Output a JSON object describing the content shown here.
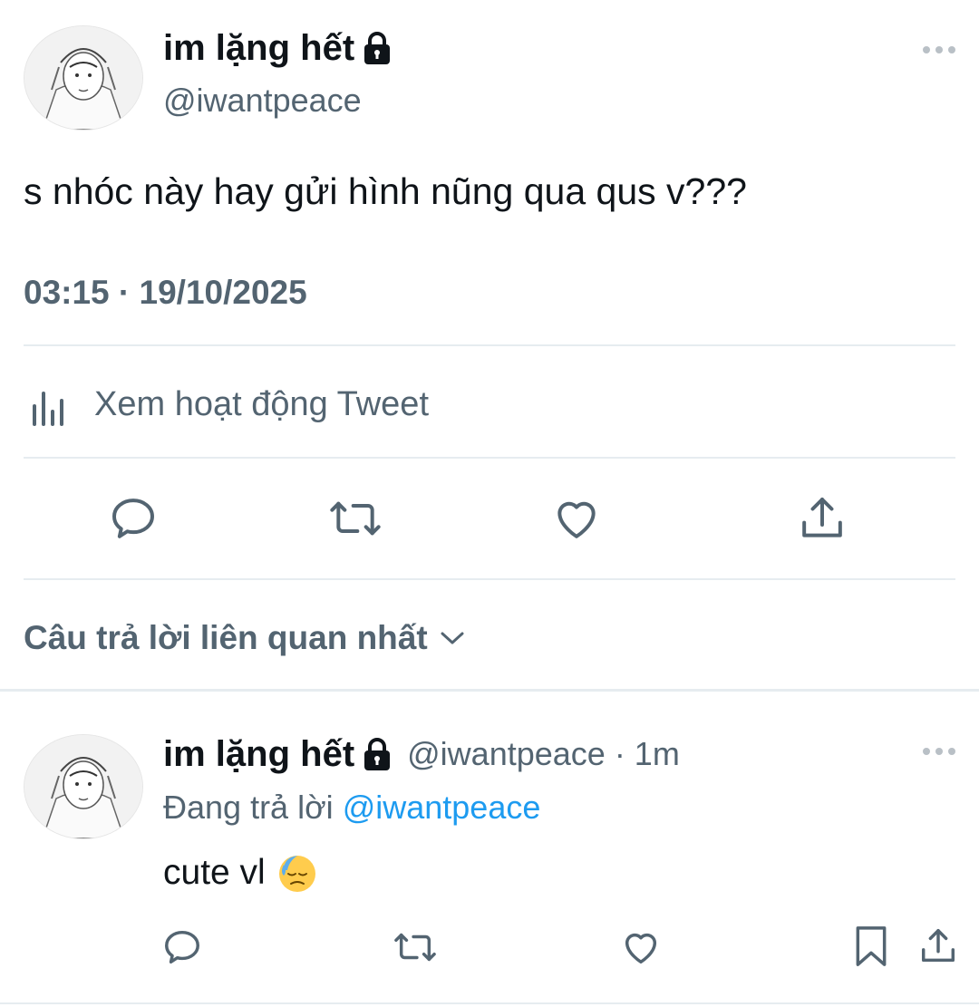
{
  "main_tweet": {
    "display_name": "im lặng hết",
    "handle": "@iwantpeace",
    "text": "s nhóc này hay gửi hình nũng qua qus v???",
    "timestamp": "03:15 · 19/10/2025",
    "activity_label": "Xem hoạt động Tweet"
  },
  "replies_filter": {
    "label": "Câu trả lời liên quan nhất"
  },
  "reply": {
    "display_name": "im lặng hết",
    "handle_time": "@iwantpeace · 1m",
    "replying_prefix": "Đang trả lời",
    "replying_to": "@iwantpeace",
    "text": "cute vl",
    "emoji": "😓"
  },
  "colors": {
    "text_primary": "#0f1419",
    "text_secondary": "#536471",
    "link": "#1d9bf0",
    "divider": "#e6ecf0"
  }
}
